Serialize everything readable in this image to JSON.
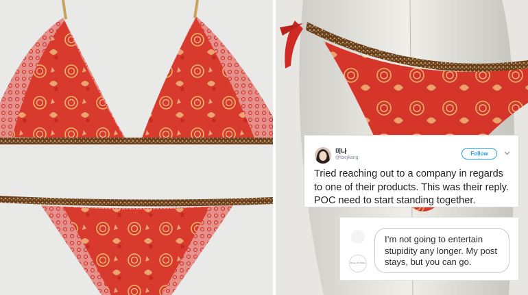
{
  "tweet": {
    "display_name": "미나",
    "handle": "@taejkang",
    "follow_label": "Follow",
    "text": "Tried reaching out to a company in regards to one of their products. This was their reply. POC need to start standing together."
  },
  "reply": {
    "avatar_label": "House Of Ohmas",
    "message": "I’m not going to entertain stupidity any longer. My post stays, but you can go."
  },
  "colors": {
    "accent": "#1da1f2",
    "fabric": "#d8372c",
    "trim": "#7a4a2a",
    "background_left": "#e9e9e8",
    "background_right": "#e7e6e2"
  }
}
